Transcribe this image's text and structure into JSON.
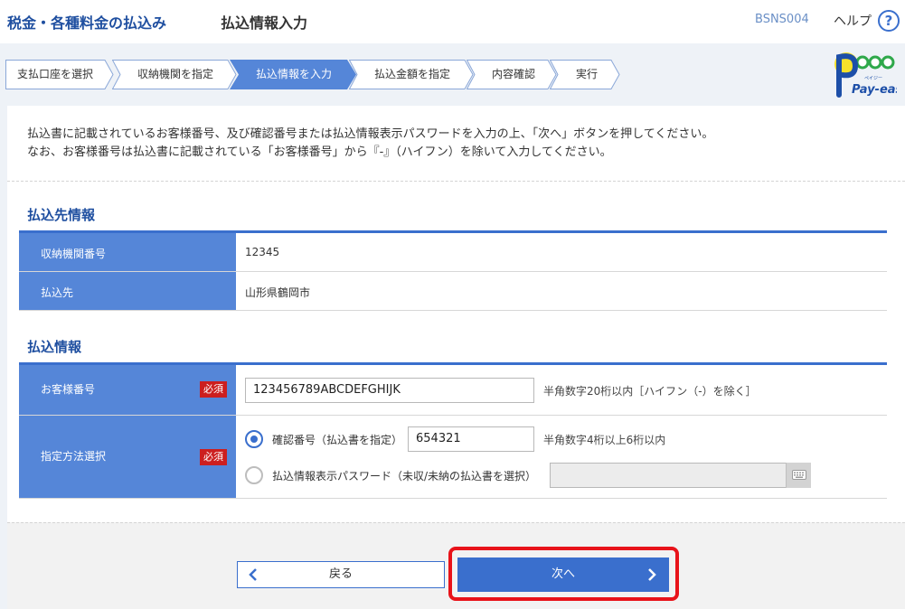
{
  "header": {
    "title": "税金・各種料金の払込み",
    "subtitle": "払込情報入力",
    "screen_code": "BSNS004",
    "help_label": "ヘルプ",
    "help_icon_glyph": "?"
  },
  "steps": [
    {
      "label": "支払口座を選択",
      "active": false
    },
    {
      "label": "収納機関を指定",
      "active": false
    },
    {
      "label": "払込情報を入力",
      "active": true
    },
    {
      "label": "払込金額を指定",
      "active": false
    },
    {
      "label": "内容確認",
      "active": false
    },
    {
      "label": "実行",
      "active": false
    }
  ],
  "logo": {
    "text": "Pay-easy",
    "kana": "ペイジー"
  },
  "intro": {
    "line1": "払込書に記載されているお客様番号、及び確認番号または払込情報表示パスワードを入力の上、「次へ」ボタンを押してください。",
    "line2": "なお、お客様番号は払込書に記載されている「お客様番号」から『-』（ハイフン）を除いて入力してください。"
  },
  "payee_section": {
    "title": "払込先情報",
    "rows": [
      {
        "label": "収納機関番号",
        "value": "12345"
      },
      {
        "label": "払込先",
        "value": "山形県鶴岡市"
      }
    ]
  },
  "payment_section": {
    "title": "払込情報",
    "customer_number": {
      "label": "お客様番号",
      "required": "必須",
      "value": "123456789ABCDEFGHIJK",
      "hint": "半角数字20桁以内［ハイフン（-）を除く］"
    },
    "method": {
      "label": "指定方法選択",
      "required": "必須",
      "option1_label": "確認番号（払込書を指定）",
      "option1_value": "654321",
      "option1_hint": "半角数字4桁以上6桁以内",
      "option1_selected": true,
      "option2_label": "払込情報表示パスワード（未収/未納の払込書を選択）",
      "option2_value": "",
      "option2_selected": false
    }
  },
  "buttons": {
    "back": "戻る",
    "next": "次へ"
  },
  "colors": {
    "accent": "#3a6fcd",
    "label_bg": "#5586d8",
    "required": "#cc1f1f",
    "highlight": "#e8131a",
    "title": "#1f4fa0"
  }
}
